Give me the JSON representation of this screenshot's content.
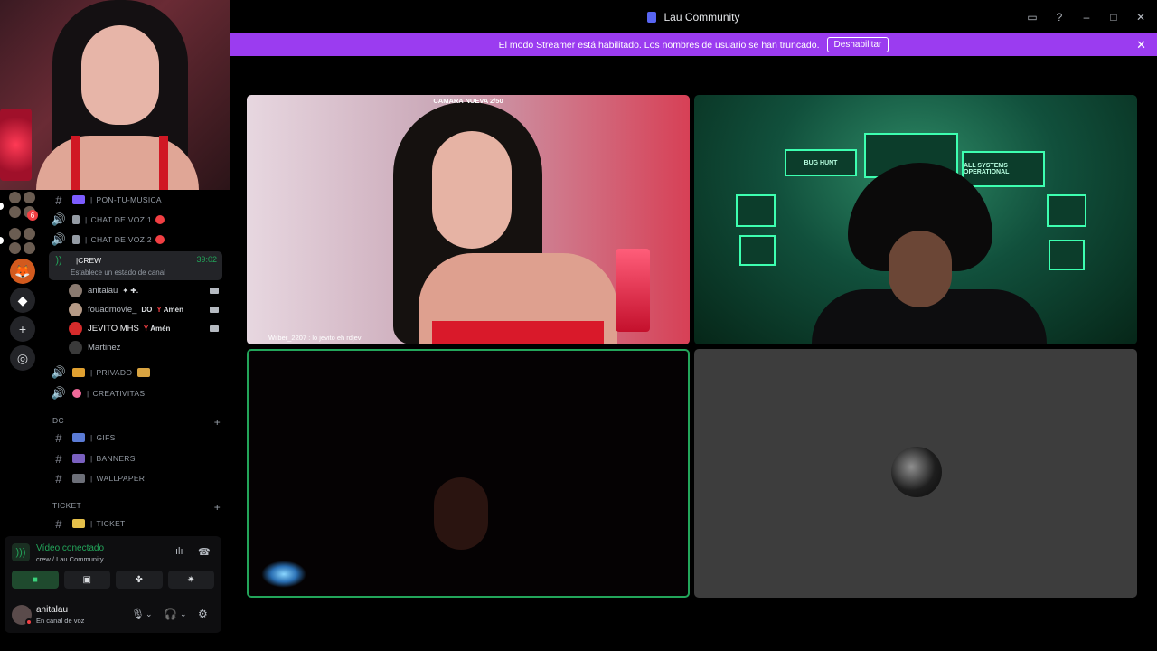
{
  "window": {
    "title": "Lau Community"
  },
  "banner": {
    "message": "El modo Streamer está habilitado. Los nombres de usuario se han truncado.",
    "button_label": "Deshabilitar"
  },
  "rail": {
    "badge_count": "6"
  },
  "channels": {
    "music": "PON-TU-MUSICA",
    "voice1": "CHAT DE VOZ 1",
    "voice2": "CHAT DE VOZ 2",
    "crew": "CREW",
    "crew_timer": "39:02",
    "crew_status": "Establece un estado de canal",
    "members": [
      {
        "name": "anitalau",
        "tag": "✦ ✚."
      },
      {
        "name": "fouadmovie_",
        "tag": "DO",
        "tag2": "Amén"
      },
      {
        "name": "JEVITO MHS",
        "tag": "Amén"
      },
      {
        "name": "Martinez",
        "tag": ""
      }
    ],
    "privado": "PRIVADO",
    "creativitas": "CREATIVITAS",
    "category_dc": "DC",
    "gifs": "GIFS",
    "banners": "BANNERS",
    "wallpaper": "WALLPAPER",
    "category_ticket": "TICKET",
    "ticket": "TICKET"
  },
  "voice_panel": {
    "title": "Vídeo conectado",
    "subtitle": "crew / Lau Community"
  },
  "user_panel": {
    "name": "anitalau",
    "status": "En canal de voz"
  },
  "video": {
    "tile1_caption_top": "CAMARA NUEVA 2/50",
    "tile1_caption_bottom": "Wilber_2207 : lo jevito eh rdjevi",
    "tile2_monitor_1": "BUG HUNT",
    "tile2_monitor_2": "ALL SYSTEMS OPERATIONAL"
  },
  "colors": {
    "accent_purple": "#9b3cf0",
    "connected_green": "#23a55a",
    "live_red": "#f23f43"
  }
}
